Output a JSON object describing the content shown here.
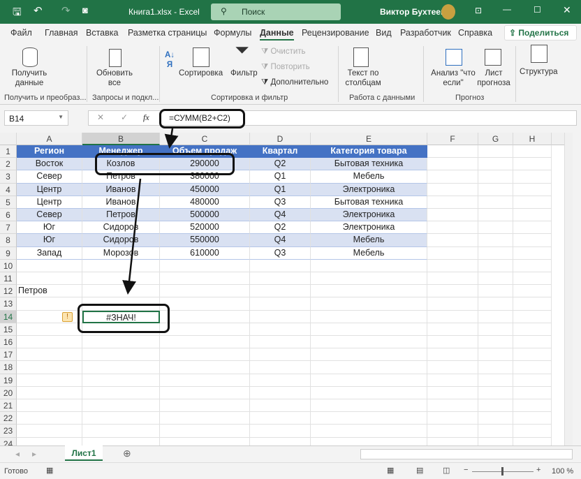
{
  "titlebar": {
    "file": "Книга1.xlsx - Excel",
    "search": "Поиск",
    "user": "Виктор Бухтеев"
  },
  "tabs": [
    "Файл",
    "Главная",
    "Вставка",
    "Разметка страницы",
    "Формулы",
    "Данные",
    "Рецензирование",
    "Вид",
    "Разработчик",
    "Справка"
  ],
  "share": "Поделиться",
  "ribbon": {
    "get_data": "Получить данные",
    "refresh": "Обновить все",
    "sort": "Сортировка",
    "filter": "Фильтр",
    "clear": "Очистить",
    "reapply": "Повторить",
    "advanced": "Дополнительно",
    "text_to_columns": "Текст по столбцам",
    "whatif": "Анализ \"что если\"",
    "forecast": "Лист прогноза",
    "outline": "Структура",
    "groups": [
      "Получить и преобраз...",
      "Запросы и подкл...",
      "Сортировка и фильтр",
      "Работа с данными",
      "Прогноз"
    ]
  },
  "formula_bar": {
    "name_box": "B14",
    "formula": "=СУММ(B2+C2)"
  },
  "columns": [
    "A",
    "B",
    "C",
    "D",
    "E",
    "F",
    "G",
    "H"
  ],
  "table": {
    "headers": [
      "Регион",
      "Менеджер",
      "Объем продаж",
      "Квартал",
      "Категория товара"
    ],
    "rows": [
      [
        "Восток",
        "Козлов",
        "290000",
        "Q2",
        "Бытовая техника"
      ],
      [
        "Север",
        "Петров",
        "380000",
        "Q1",
        "Мебель"
      ],
      [
        "Центр",
        "Иванов",
        "450000",
        "Q1",
        "Электроника"
      ],
      [
        "Центр",
        "Иванов",
        "480000",
        "Q3",
        "Бытовая техника"
      ],
      [
        "Север",
        "Петров",
        "500000",
        "Q4",
        "Электроника"
      ],
      [
        "Юг",
        "Сидоров",
        "520000",
        "Q2",
        "Электроника"
      ],
      [
        "Юг",
        "Сидоров",
        "550000",
        "Q4",
        "Мебель"
      ],
      [
        "Запад",
        "Морозов",
        "610000",
        "Q3",
        "Мебель"
      ]
    ]
  },
  "a12": "Петров",
  "b14": "#ЗНАЧ!",
  "sheet_tab": "Лист1",
  "status": {
    "ready": "Готово",
    "zoom": "100 %"
  }
}
